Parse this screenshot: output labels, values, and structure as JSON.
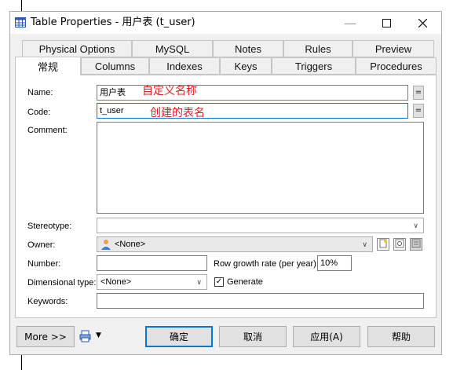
{
  "window": {
    "title": "Table Properties - 用户表 (t_user)"
  },
  "tabs_row1": [
    "Physical Options",
    "MySQL",
    "Notes",
    "Rules",
    "Preview"
  ],
  "tabs_row2": [
    "常规",
    "Columns",
    "Indexes",
    "Keys",
    "Triggers",
    "Procedures"
  ],
  "active_tab": "常规",
  "form": {
    "name_label": "Name:",
    "name_value": "用户表",
    "name_annotation": "自定义名称",
    "code_label": "Code:",
    "code_value": "t_user",
    "code_annotation": "创建的表名",
    "comment_label": "Comment:",
    "comment_value": "",
    "stereotype_label": "Stereotype:",
    "stereotype_value": "",
    "owner_label": "Owner:",
    "owner_value": "<None>",
    "number_label": "Number:",
    "number_value": "",
    "row_growth_label": "Row growth rate (per year):",
    "row_growth_value": "10%",
    "dimensional_label": "Dimensional type:",
    "dimensional_value": "<None>",
    "generate_label": "Generate",
    "generate_checked": true,
    "keywords_label": "Keywords:",
    "keywords_value": "",
    "eq_symbol": "="
  },
  "buttons": {
    "more": "More >>",
    "ok": "确定",
    "cancel": "取消",
    "apply": "应用(A)",
    "help": "帮助"
  },
  "icons": {
    "title": "table-icon",
    "owner": "user-icon",
    "owner_new": "new-icon",
    "owner_props": "properties-icon",
    "owner_list": "list-icon",
    "print": "printer-icon"
  },
  "colors": {
    "accent": "#0078d7",
    "annotation": "#e02020"
  }
}
